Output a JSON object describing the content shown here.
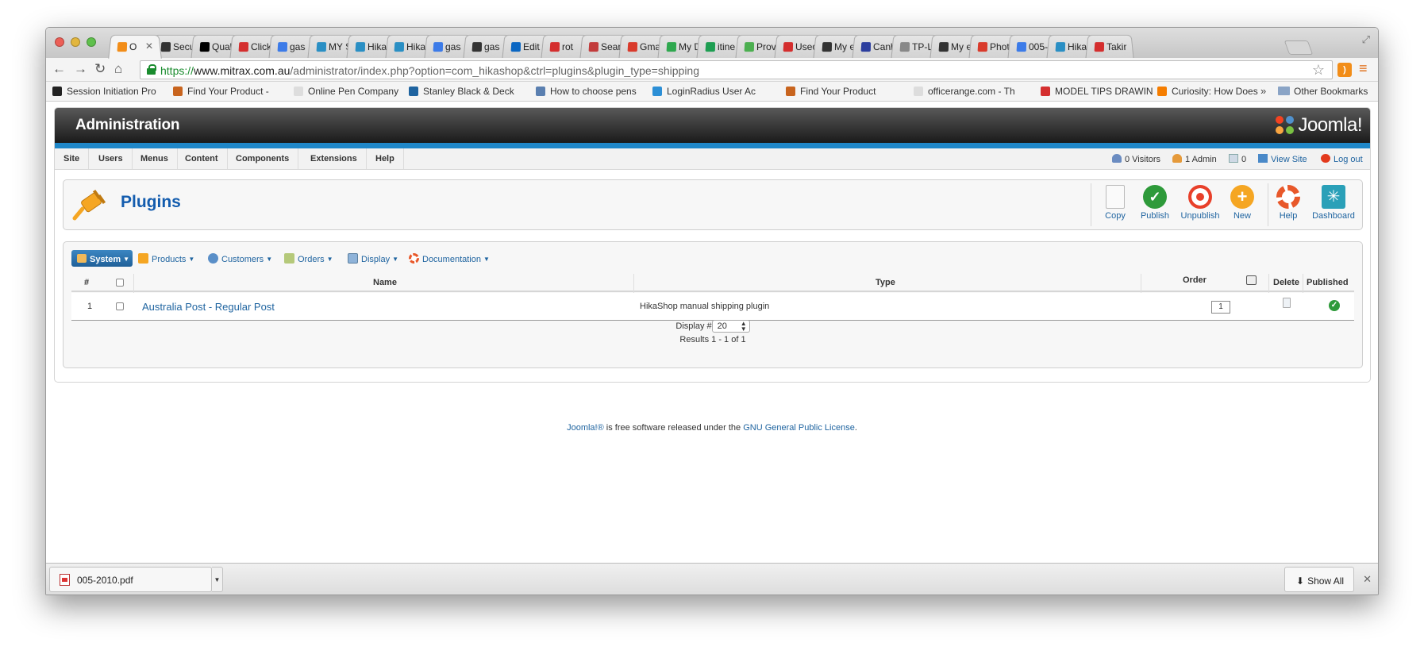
{
  "browser": {
    "tabs": [
      {
        "label": "O",
        "color": "#f28d18",
        "active": true
      },
      {
        "label": "Secu",
        "color": "#333333"
      },
      {
        "label": "Qual",
        "color": "#000000"
      },
      {
        "label": "Click",
        "color": "#d42e2e"
      },
      {
        "label": "gas",
        "color": "#3c7be8"
      },
      {
        "label": "MY S",
        "color": "#2a8fc4"
      },
      {
        "label": "Hika",
        "color": "#2a8fc4"
      },
      {
        "label": "Hika",
        "color": "#2a8fc4"
      },
      {
        "label": "gas",
        "color": "#3c7be8"
      },
      {
        "label": "gas",
        "color": "#333333"
      },
      {
        "label": "Edit",
        "color": "#0a66c2"
      },
      {
        "label": "rot",
        "color": "#d42e2e"
      },
      {
        "label": "Searc",
        "color": "#c23b3b"
      },
      {
        "label": "Gma",
        "color": "#d93a2b"
      },
      {
        "label": "My D",
        "color": "#2fa84f"
      },
      {
        "label": "itine",
        "color": "#1e9e52"
      },
      {
        "label": "Prov",
        "color": "#4caf50"
      },
      {
        "label": "Used",
        "color": "#d42e2e"
      },
      {
        "label": "My e",
        "color": "#333333"
      },
      {
        "label": "Canb",
        "color": "#2c3e9e"
      },
      {
        "label": "TP-L",
        "color": "#888888"
      },
      {
        "label": "My e",
        "color": "#333333"
      },
      {
        "label": "Phot",
        "color": "#d93a2b"
      },
      {
        "label": "005-",
        "color": "#3c7be8"
      },
      {
        "label": "Hika",
        "color": "#2a8fc4"
      },
      {
        "label": "Takir",
        "color": "#d42e2e"
      }
    ],
    "url": {
      "scheme": "https://",
      "host": "www.mitrax.com.au",
      "path": "/administrator/index.php?option=com_hikashop&ctrl=plugins&plugin_type=shipping"
    },
    "bookmarks": [
      {
        "label": "Session Initiation Pro",
        "icon": "wikipedia-w-icon",
        "color": "#222222"
      },
      {
        "label": "Find Your Product -",
        "icon": "product-icon",
        "color": "#c8641e"
      },
      {
        "label": "Online Pen Company",
        "icon": "page-icon",
        "color": "#dddddd"
      },
      {
        "label": "Stanley Black & Deck",
        "icon": "hi-icon",
        "color": "#1f64a0"
      },
      {
        "label": "How to choose pens",
        "icon": "pen-icon",
        "color": "#5a7fb0"
      },
      {
        "label": "LoginRadius User Ac",
        "icon": "lr-icon",
        "color": "#2c8fd6"
      },
      {
        "label": "Find Your Product",
        "icon": "product-icon",
        "color": "#c8641e"
      },
      {
        "label": "officerange.com - Th",
        "icon": "page-icon",
        "color": "#dddddd"
      },
      {
        "label": "MODEL TIPS DRAWIN",
        "icon": "model-icon",
        "color": "#d42e2e"
      },
      {
        "label": "Curiosity: How Does",
        "icon": "blogger-icon",
        "color": "#f57d00"
      }
    ],
    "bookmarks_overflow": "»",
    "other_bookmarks": "Other Bookmarks"
  },
  "admin": {
    "title": "Administration",
    "logo_text": "Joomla!",
    "menu": [
      "Site",
      "Users",
      "Menus",
      "Content",
      "Components",
      "Extensions",
      "Help"
    ],
    "status": {
      "visitors": "0 Visitors",
      "admins": "1 Admin",
      "messages": "0",
      "view_site": "View Site",
      "logout": "Log out"
    },
    "page_title": "Plugins",
    "toolbar": {
      "copy": "Copy",
      "publish": "Publish",
      "unpublish": "Unpublish",
      "new": "New",
      "help": "Help",
      "dashboard": "Dashboard"
    },
    "submenu": {
      "system": "System",
      "products": "Products",
      "customers": "Customers",
      "orders": "Orders",
      "display": "Display",
      "documentation": "Documentation"
    },
    "table": {
      "headers": {
        "num": "#",
        "name": "Name",
        "type": "Type",
        "order": "Order",
        "delete": "Delete",
        "published": "Published"
      },
      "rows": [
        {
          "num": "1",
          "name": "Australia Post - Regular Post",
          "type": "HikaShop manual shipping plugin",
          "order": "1",
          "published": true
        }
      ]
    },
    "pager": {
      "display_label": "Display #",
      "display_value": "20",
      "results": "Results 1 - 1 of 1"
    },
    "footer": {
      "joomla_link": "Joomla!®",
      "text": " is free software released under the ",
      "license_link": "GNU General Public License",
      "end": "."
    }
  },
  "downloads": {
    "file": "005-2010.pdf",
    "show_all": "Show All"
  },
  "colors": {
    "accent_blue": "#1f87c8",
    "link_blue": "#1f64a0",
    "publish_green": "#2e9a3a",
    "unpublish_red": "#e8402a",
    "new_orange": "#f5a623"
  }
}
